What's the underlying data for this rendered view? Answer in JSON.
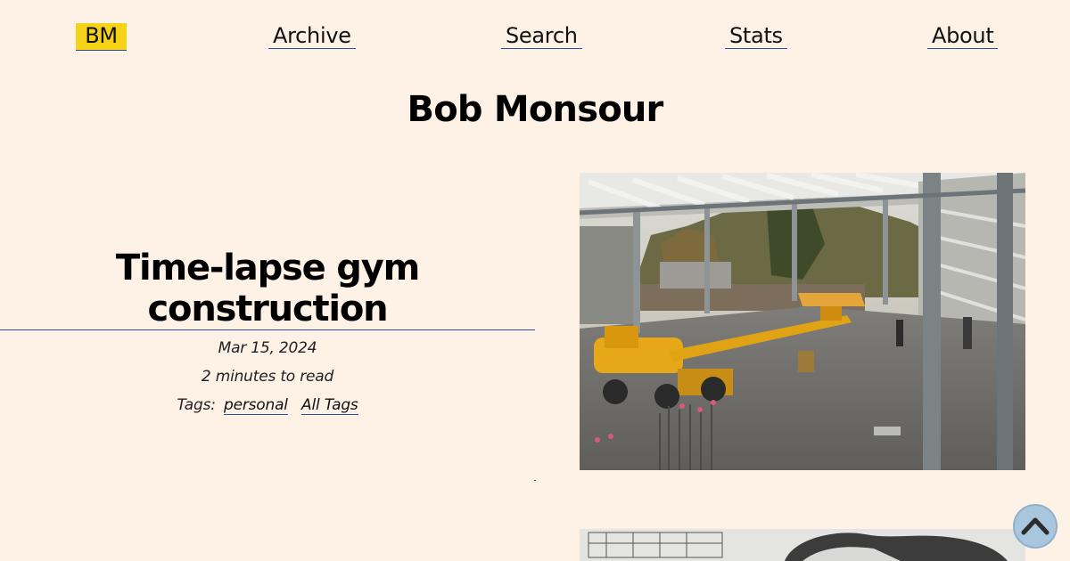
{
  "nav": {
    "logo": "BM",
    "items": [
      {
        "label": "Archive"
      },
      {
        "label": "Search"
      },
      {
        "label": "Stats"
      },
      {
        "label": "About"
      }
    ]
  },
  "site": {
    "title": "Bob Monsour"
  },
  "post": {
    "title": "Time-lapse gym construction",
    "date": "Mar 15, 2024",
    "read_time": "2 minutes to read",
    "tags_label": "Tags:",
    "tags": [
      "personal",
      "All Tags"
    ]
  },
  "images": {
    "hero": "construction-site-photo",
    "next": "sketch-illustration"
  },
  "icons": {
    "back_to_top": "chevron-up-icon"
  },
  "colors": {
    "background": "#fef1e6",
    "logo_bg": "#f6d316",
    "link_underline": "#2b4fa8",
    "back_to_top_bg": "#a9c6df"
  }
}
